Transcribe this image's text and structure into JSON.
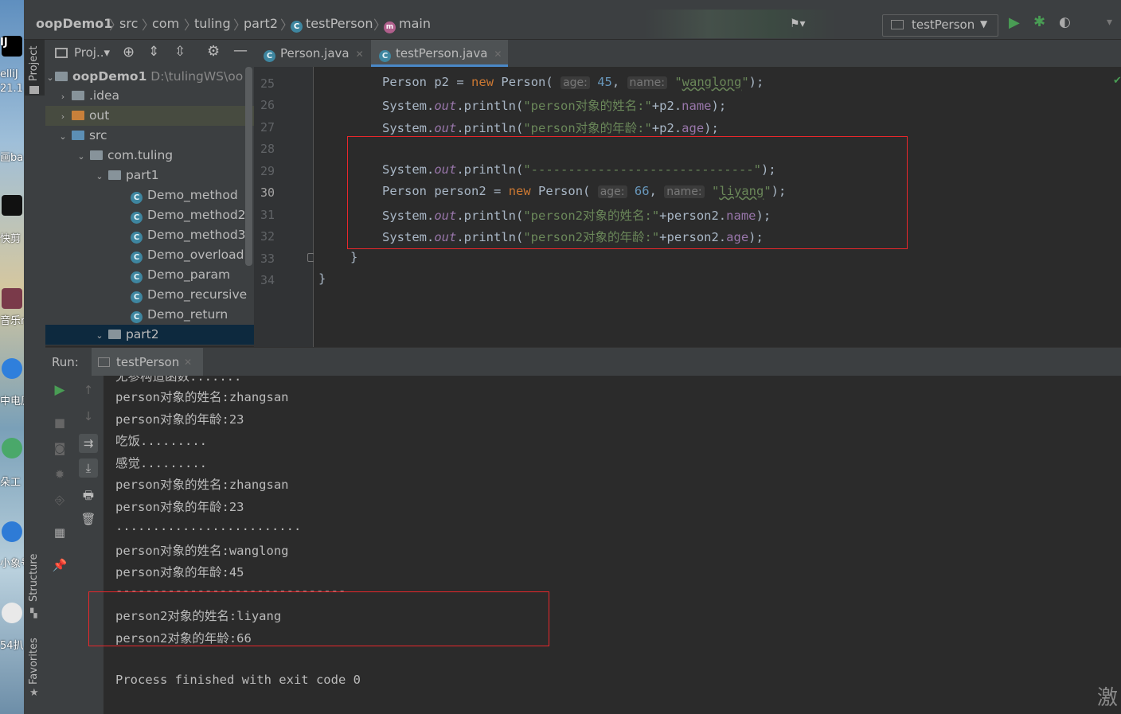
{
  "desktop": {
    "labels": [
      "IJ",
      "elliJ",
      "21.1",
      "画ba",
      "快剪",
      "音乐r",
      "中电原",
      "朵工",
      "小象号",
      "54扒"
    ]
  },
  "breadcrumb": [
    "oopDemo1",
    "src",
    "com",
    "tuling",
    "part2",
    "testPerson",
    "main"
  ],
  "run_config": {
    "label": "testPerson"
  },
  "project_header": {
    "label": "Proj..▾"
  },
  "side_labels": {
    "project": "Project",
    "structure": "Structure",
    "favorites": "Favorites"
  },
  "tabs": [
    {
      "label": "Person.java",
      "active": false
    },
    {
      "label": "testPerson.java",
      "active": true
    }
  ],
  "project_tree": [
    {
      "label": "oopDemo1",
      "suffix": "D:\\tulingWS\\oopD",
      "level": 0,
      "type": "module",
      "expanded": true
    },
    {
      "label": ".idea",
      "level": 1,
      "type": "folder",
      "expanded": false
    },
    {
      "label": "out",
      "level": 1,
      "type": "folder-orange",
      "expanded": false
    },
    {
      "label": "src",
      "level": 1,
      "type": "folder-blue",
      "expanded": true
    },
    {
      "label": "com.tuling",
      "level": 2,
      "type": "package",
      "expanded": true
    },
    {
      "label": "part1",
      "level": 3,
      "type": "package",
      "expanded": true
    },
    {
      "label": "Demo_method",
      "level": 4,
      "type": "class"
    },
    {
      "label": "Demo_method2",
      "level": 4,
      "type": "class"
    },
    {
      "label": "Demo_method3",
      "level": 4,
      "type": "class"
    },
    {
      "label": "Demo_overload",
      "level": 4,
      "type": "class"
    },
    {
      "label": "Demo_param",
      "level": 4,
      "type": "class"
    },
    {
      "label": "Demo_recursive",
      "level": 4,
      "type": "class"
    },
    {
      "label": "Demo_return",
      "level": 4,
      "type": "class"
    },
    {
      "label": "part2",
      "level": 3,
      "type": "package",
      "expanded": true
    }
  ],
  "line_numbers": [
    "25",
    "26",
    "27",
    "28",
    "29",
    "30",
    "31",
    "32",
    "33",
    "34"
  ],
  "code": {
    "l25": {
      "type": "Person",
      "var": "p2",
      "eq": "=",
      "new": "new",
      "ctor": "Person(",
      "hint_age": "age:",
      "age": "45",
      "hint_name": "name:",
      "q1": "\"",
      "name": "wanglong",
      "q2": "\"",
      "end": ");"
    },
    "l26": {
      "pre": "System.",
      "out": "out",
      "mid": ".println(",
      "str": "\"person对象的姓名:\"",
      "plus": "+p2.",
      "field": "name",
      "end": ");"
    },
    "l27": {
      "pre": "System.",
      "out": "out",
      "mid": ".println(",
      "str": "\"person对象的年龄:\"",
      "plus": "+p2.",
      "field": "age",
      "end": ");"
    },
    "l29": {
      "pre": "System.",
      "out": "out",
      "mid": ".println(",
      "str": "\"------------------------------\"",
      "end": ");"
    },
    "l30": {
      "type": "Person",
      "var": "person2",
      "eq": "=",
      "new": "new",
      "ctor": "Person(",
      "hint_age": "age:",
      "age": "66",
      "hint_name": "name:",
      "q1": "\"",
      "name": "liyang",
      "q2": "\"",
      "end": ");"
    },
    "l31": {
      "pre": "System.",
      "out": "out",
      "mid": ".println(",
      "str": "\"person2对象的姓名:\"",
      "plus": "+person2.",
      "field": "name",
      "end": ");"
    },
    "l32": {
      "pre": "System.",
      "out": "out",
      "mid": ".println(",
      "str": "\"person2对象的年龄:\"",
      "plus": "+person2.",
      "field": "age",
      "end": ");"
    },
    "l33": "}",
    "l34": "}"
  },
  "run_panel": {
    "label": "Run:",
    "tab": "testPerson"
  },
  "console_lines": [
    "无参构造函数.......",
    "person对象的姓名:zhangsan",
    "person对象的年龄:23",
    "吃饭.........",
    "感觉.........",
    "person对象的姓名:zhangsan",
    "person对象的年龄:23",
    ".........................",
    "person对象的姓名:wanglong",
    "person对象的年龄:45",
    "-------------------------------",
    "person2对象的姓名:liyang",
    "person2对象的年龄:66",
    "",
    "Process finished with exit code 0"
  ],
  "corner_text": "激",
  "colors": {
    "accent": "#4a88c7",
    "highlight_box": "#e8272b",
    "run_green": "#499c54"
  }
}
